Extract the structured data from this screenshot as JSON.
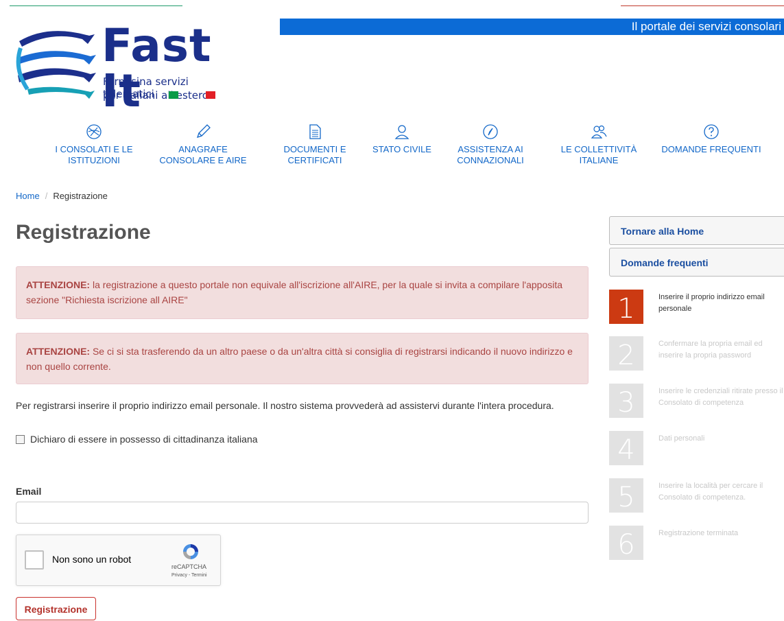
{
  "header": {
    "tagline": "Il portale dei servizi consolari",
    "logo": {
      "title": "Fast It",
      "subtitle_line1": "Farnesina servizi telematici",
      "subtitle_line2": "per Italiani all'estero",
      "flag_colors": [
        "#0a9b48",
        "#ffffff",
        "#e21f26"
      ]
    }
  },
  "nav": {
    "items": [
      {
        "icon": "globe-icon",
        "line1": "I CONSOLATI E LE",
        "line2": "ISTITUZIONI"
      },
      {
        "icon": "pencil-icon",
        "line1": "ANAGRAFE",
        "line2": "CONSOLARE E AIRE"
      },
      {
        "icon": "document-icon",
        "line1": "DOCUMENTI E",
        "line2": "CERTIFICATI"
      },
      {
        "icon": "person-icon",
        "line1": "STATO CIVILE",
        "line2": ""
      },
      {
        "icon": "compass-icon",
        "line1": "ASSISTENZA AI",
        "line2": "CONNAZIONALI"
      },
      {
        "icon": "people-icon",
        "line1": "LE COLLETTIVITÀ",
        "line2": "ITALIANE"
      },
      {
        "icon": "question-icon",
        "line1": "DOMANDE FREQUENTI",
        "line2": ""
      }
    ]
  },
  "breadcrumb": {
    "home": "Home",
    "separator": "/",
    "current": "Registrazione"
  },
  "main": {
    "title": "Registrazione",
    "alert1": {
      "strong": "ATTENZIONE:",
      "text": " la registrazione a questo portale non equivale all'iscrizione all'AIRE, per la quale si invita a compilare l'apposita sezione \"Richiesta iscrizione all AIRE\""
    },
    "alert2": {
      "strong": "ATTENZIONE:",
      "text": " Se ci si sta trasferendo da un altro paese o da un'altra città si consiglia di registrarsi indicando il nuovo indirizzo e non quello corrente."
    },
    "intro": "Per registrarsi inserire il proprio indirizzo email personale. Il nostro sistema provvederà ad assistervi durante l'intera procedura.",
    "citizenship_checkbox": "Dichiaro di essere in possesso di cittadinanza italiana",
    "email_label": "Email",
    "email_value": "",
    "captcha": {
      "label": "Non sono un robot",
      "brand": "reCAPTCHA",
      "links": "Privacy - Termini"
    },
    "submit_label": "Registrazione"
  },
  "sidebar": {
    "links": [
      "Tornare alla Home",
      "Domande frequenti"
    ],
    "steps": [
      {
        "num": "1",
        "text": "Inserire il proprio indirizzo email personale",
        "active": true
      },
      {
        "num": "2",
        "text": "Confermare la propria email ed inserire la propria password",
        "active": false
      },
      {
        "num": "3",
        "text": "Inserire le credenziali ritirate presso il Consolato di competenza",
        "active": false
      },
      {
        "num": "4",
        "text": "Dati personali",
        "active": false
      },
      {
        "num": "5",
        "text": "Inserire la località per cercare il Consolato di competenza.",
        "active": false
      },
      {
        "num": "6",
        "text": "Registrazione terminata",
        "active": false
      }
    ]
  },
  "colors": {
    "brand_blue": "#0c6bd6",
    "link_blue": "#1267c8",
    "alert_bg": "#f2dede",
    "alert_text": "#a94442",
    "step_active": "#cc3a12"
  }
}
